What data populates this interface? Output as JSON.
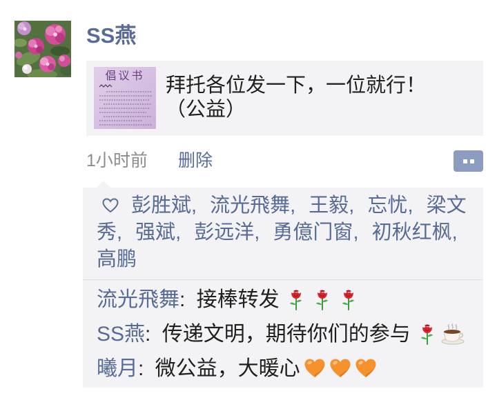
{
  "post": {
    "author": "SS燕",
    "avatar_icon": "flower-photo",
    "link_card": {
      "thumbnail_title": "倡议书",
      "title_lines": [
        "拜托各位发一下，一位就行！",
        "（公益）"
      ]
    },
    "time": "1小时前",
    "delete_label": "删除",
    "comment_button_icon": "comment-dots-icon"
  },
  "likes": {
    "icon": "heart-outline-icon",
    "names": [
      "彭胜斌",
      "流光飛舞",
      "王毅",
      "忘忧",
      "梁文秀",
      "强斌",
      "彭远洋",
      "勇億门窗",
      "初秋红枫",
      "高鹏"
    ],
    "separator": ", "
  },
  "comment_separator": ": ",
  "comments": [
    {
      "author": "流光飛舞",
      "text": "接棒转发",
      "emoji": [
        "rose",
        "rose",
        "rose"
      ]
    },
    {
      "author": "SS燕",
      "text": "传递文明，期待你们的参与",
      "emoji": [
        "rose",
        "hot-beverage"
      ]
    },
    {
      "author": "曦月",
      "text": "微公益，大暖心",
      "emoji": [
        "orange-heart",
        "orange-heart",
        "orange-heart"
      ]
    }
  ],
  "colors": {
    "link_blue": "#576b95",
    "text": "#1f1f1f",
    "muted": "#8c8c8c",
    "panel": "#f3f3f5",
    "comment_button": "#8b9cc0",
    "rose": "#d9232d",
    "orange_heart": "#f5922e"
  }
}
